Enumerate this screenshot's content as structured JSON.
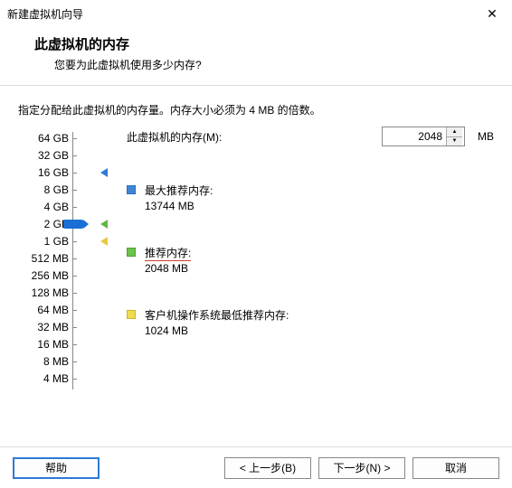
{
  "window": {
    "title": "新建虚拟机向导",
    "close_glyph": "✕"
  },
  "header": {
    "title": "此虚拟机的内存",
    "subtitle": "您要为此虚拟机使用多少内存?"
  },
  "instruction": "指定分配给此虚拟机的内存量。内存大小必须为 4 MB 的倍数。",
  "memory": {
    "label": "此虚拟机的内存(M):",
    "value": "2048",
    "unit": "MB"
  },
  "scale": [
    "64 GB",
    "32 GB",
    "16 GB",
    "8 GB",
    "4 GB",
    "2 GB",
    "1 GB",
    "512 MB",
    "256 MB",
    "128 MB",
    "64 MB",
    "32 MB",
    "16 MB",
    "8 MB",
    "4 MB"
  ],
  "recs": {
    "max": {
      "label": "最大推荐内存:",
      "value": "13744 MB"
    },
    "rec": {
      "label": "推荐内存:",
      "value": "2048 MB"
    },
    "min": {
      "label": "客户机操作系统最低推荐内存:",
      "value": "1024 MB"
    }
  },
  "buttons": {
    "help": "帮助",
    "back": "< 上一步(B)",
    "next": "下一步(N) >",
    "cancel": "取消"
  }
}
